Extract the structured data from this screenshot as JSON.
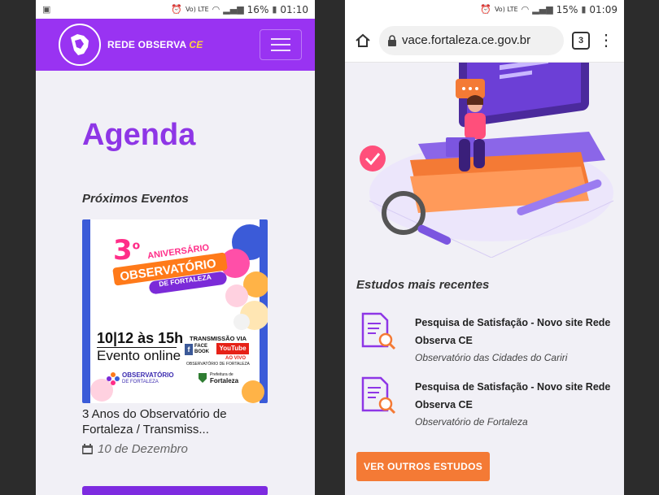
{
  "left_phone": {
    "status": {
      "signal": "Vo) LTE",
      "battery": "16%",
      "time": "01:10"
    },
    "header": {
      "brand": "REDE OBSERVA",
      "brand_accent": "CE"
    },
    "page_title": "Agenda",
    "section_label": "Próximos Eventos",
    "event": {
      "poster": {
        "number": "3",
        "ordinal": "o",
        "line1": "ANIVERSÁRIO",
        "line2": "OBSERVATÓRIO",
        "line3": "DE FORTALEZA",
        "time": "10|12 às 15h",
        "format": "Evento online",
        "stream_label": "TRANSMISSÃO VIA",
        "facebook": "FACE BOOK",
        "youtube": "YouTube",
        "live": "AO VIVO",
        "org": "OBSERVATÓRIO DE FORTALEZA",
        "logo1_line1": "OBSERVATÓRIO",
        "logo1_line2": "DE FORTALEZA",
        "logo2_line1": "Prefeitura de",
        "logo2_line2": "Fortaleza"
      },
      "title": "3 Anos do Observatório de Fortaleza / Transmiss...",
      "date": "10 de Dezembro"
    }
  },
  "right_phone": {
    "status": {
      "signal": "Vo) LTE",
      "battery": "15%",
      "time": "01:09"
    },
    "browser": {
      "url": "vace.fortaleza.ce.gov.br",
      "tabs": "3"
    },
    "studies_title": "Estudos mais recentes",
    "studies": [
      {
        "name": "Pesquisa de Satisfação - Novo site Rede Observa CE",
        "source": "Observatório das Cidades do Cariri"
      },
      {
        "name": "Pesquisa de Satisfação - Novo site Rede Observa CE",
        "source": "Observatório de Fortaleza"
      }
    ],
    "cta": "VER OUTROS ESTUDOS"
  },
  "colors": {
    "purple": "#9933f2",
    "orange": "#f47a35",
    "yellow_accent": "#ffd23f"
  }
}
